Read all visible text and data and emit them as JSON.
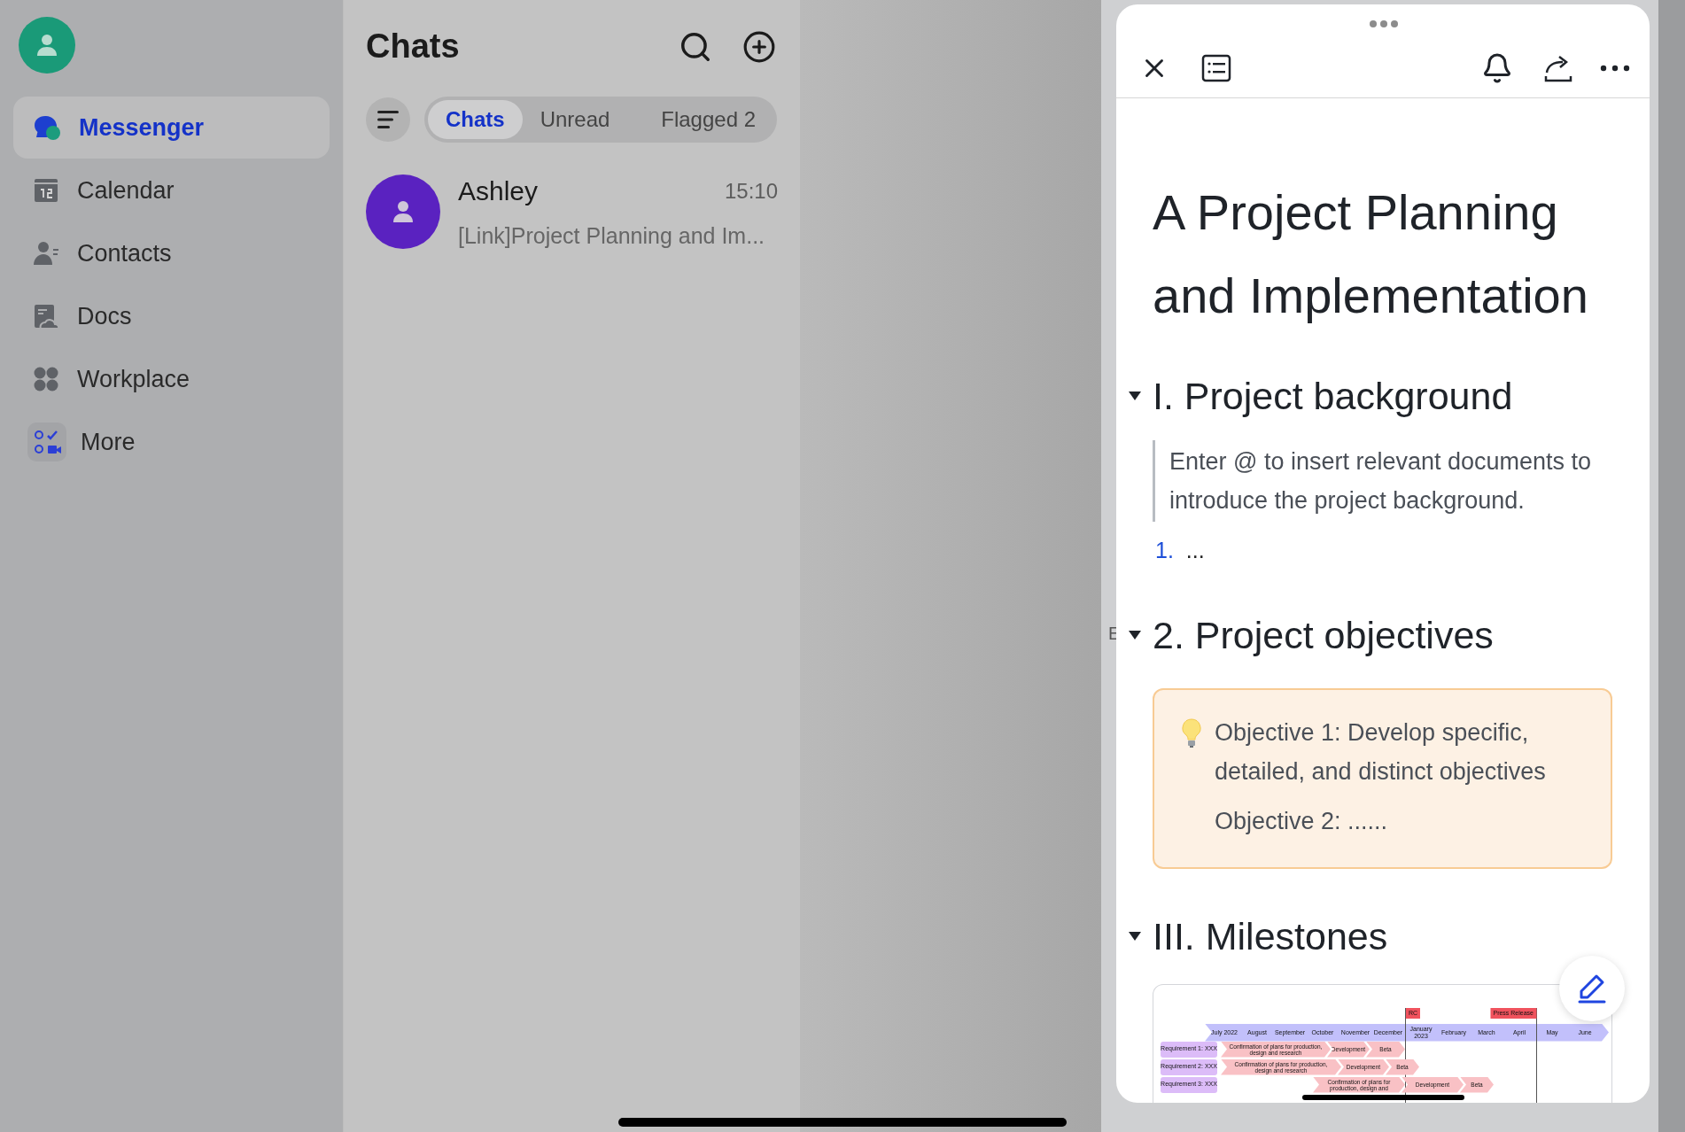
{
  "sidebar": {
    "items": [
      {
        "label": "Messenger",
        "kind": "messenger",
        "selected": true
      },
      {
        "label": "Calendar",
        "kind": "calendar",
        "selected": false
      },
      {
        "label": "Contacts",
        "kind": "contacts",
        "selected": false
      },
      {
        "label": "Docs",
        "kind": "docs",
        "selected": false
      },
      {
        "label": "Workplace",
        "kind": "workplace",
        "selected": false
      },
      {
        "label": "More",
        "kind": "more",
        "selected": false
      }
    ]
  },
  "chats": {
    "title": "Chats",
    "filter_tabs": [
      {
        "label": "Chats",
        "selected": true
      },
      {
        "label": "Unread",
        "selected": false
      },
      {
        "label": "Flagged 2",
        "selected": false
      }
    ],
    "conversations": [
      {
        "name": "Ashley",
        "time": "15:10",
        "preview": "[Link]Project Planning and Im..."
      }
    ]
  },
  "margin_fragment": "E",
  "document": {
    "title": "A Project Planning and Implementation",
    "sections": [
      {
        "heading": "I. Project background",
        "expanded": true,
        "blocks": [
          {
            "kind": "quote",
            "text": "Enter @ to insert relevant documents to introduce the project background."
          },
          {
            "kind": "numbered",
            "number": "1.",
            "text": "..."
          }
        ]
      },
      {
        "heading": "2. Project objectives",
        "expanded": true,
        "blocks": [
          {
            "kind": "callout",
            "lines": [
              "Objective 1: Develop specific, detailed, and distinct objectives",
              "Objective 2: ......"
            ]
          }
        ]
      },
      {
        "heading": "III. Milestones",
        "expanded": true,
        "blocks": [
          {
            "kind": "timeline",
            "months": [
              "July 2022",
              "August",
              "September",
              "October",
              "November",
              "December",
              "January 2023",
              "February",
              "March",
              "April",
              "May",
              "June"
            ],
            "flags": [
              "RC",
              "Press Release"
            ],
            "rows": [
              {
                "label": "Requirement 1: XXX",
                "phases": [
                  "Confirmation of plans for production, design and research",
                  "Development",
                  "Beta"
                ]
              },
              {
                "label": "Requirement 2: XXX",
                "phases": [
                  "Confirmation of plans for production, design and research",
                  "Development",
                  "Beta"
                ]
              },
              {
                "label": "Requirement 3: XXX",
                "phases": [
                  "Confirmation of plans for production, design and",
                  "Development",
                  "Beta"
                ]
              }
            ]
          }
        ]
      }
    ]
  }
}
